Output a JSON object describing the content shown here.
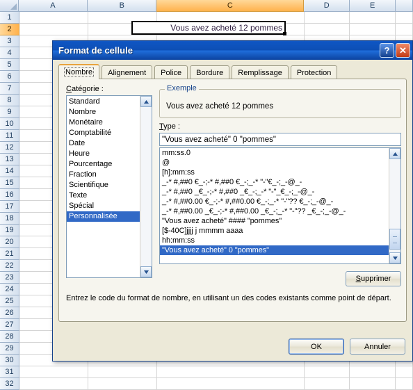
{
  "spreadsheet": {
    "columns": [
      "A",
      "B",
      "C",
      "D",
      "E"
    ],
    "selected_column": "C",
    "rows": [
      1,
      2,
      3,
      4,
      5,
      6,
      7,
      8,
      9,
      10,
      11,
      12,
      13,
      14,
      15,
      16,
      17,
      18,
      19,
      20,
      21,
      22,
      23,
      24,
      25,
      26,
      27,
      28,
      29,
      30,
      31,
      32
    ],
    "selected_row": 2,
    "active_cell": {
      "ref": "C2",
      "value": "Vous avez acheté 12 pommes"
    }
  },
  "dialog": {
    "title": "Format de cellule",
    "help_glyph": "?",
    "close_glyph": "✕",
    "tabs": [
      {
        "label": "Nombre",
        "active": true
      },
      {
        "label": "Alignement",
        "active": false
      },
      {
        "label": "Police",
        "active": false
      },
      {
        "label": "Bordure",
        "active": false
      },
      {
        "label": "Remplissage",
        "active": false
      },
      {
        "label": "Protection",
        "active": false
      }
    ],
    "category": {
      "label_prefix": "C",
      "label_rest": "atégorie :",
      "items": [
        "Standard",
        "Nombre",
        "Monétaire",
        "Comptabilité",
        "Date",
        "Heure",
        "Pourcentage",
        "Fraction",
        "Scientifique",
        "Texte",
        "Spécial",
        "Personnalisée"
      ],
      "selected": "Personnalisée"
    },
    "example": {
      "legend": "Exemple",
      "value": "Vous avez acheté 12 pommes"
    },
    "type": {
      "label_prefix": "T",
      "label_rest": "ype :",
      "value": "\"Vous avez acheté\" 0 \"pommes\"",
      "placeholder": ""
    },
    "format_codes": {
      "items": [
        "mm:ss.0",
        "@",
        "[h]:mm:ss",
        "_-* #,##0 €_-;-* #,##0 €_-;_-* \"-\"€_-;_-@_-",
        "_-* #,##0 _€_-;-* #,##0 _€_-;_-* \"-\"_€_-;_-@_-",
        "_-* #,##0.00 €_-;-* #,##0.00 €_-;_-* \"-\"?? €_-;_-@_-",
        "_-* #,##0.00 _€_-;-* #,##0.00 _€_-;_-* \"-\"?? _€_-;_-@_-",
        "\"Vous avez acheté\" #### \"pommes\"",
        "[$-40C]jjjj j mmmm aaaa",
        "hh:mm:ss",
        "\"Vous avez acheté\" 0 \"pommes\""
      ],
      "selected_index": 10
    },
    "delete_button": {
      "label_prefix": "S",
      "label_rest": "upprimer"
    },
    "hint": "Entrez le code du format de nombre, en utilisant un des codes existants comme point de départ.",
    "footer": {
      "ok_label": "OK",
      "cancel_label": "Annuler"
    }
  },
  "colors": {
    "titlebar_blue": "#0d4fb5",
    "selection_blue": "#3169c6",
    "tab_accent_orange": "#e8a33d",
    "column_selected_orange": "#ffb24d",
    "dialog_face": "#ece9d8"
  }
}
